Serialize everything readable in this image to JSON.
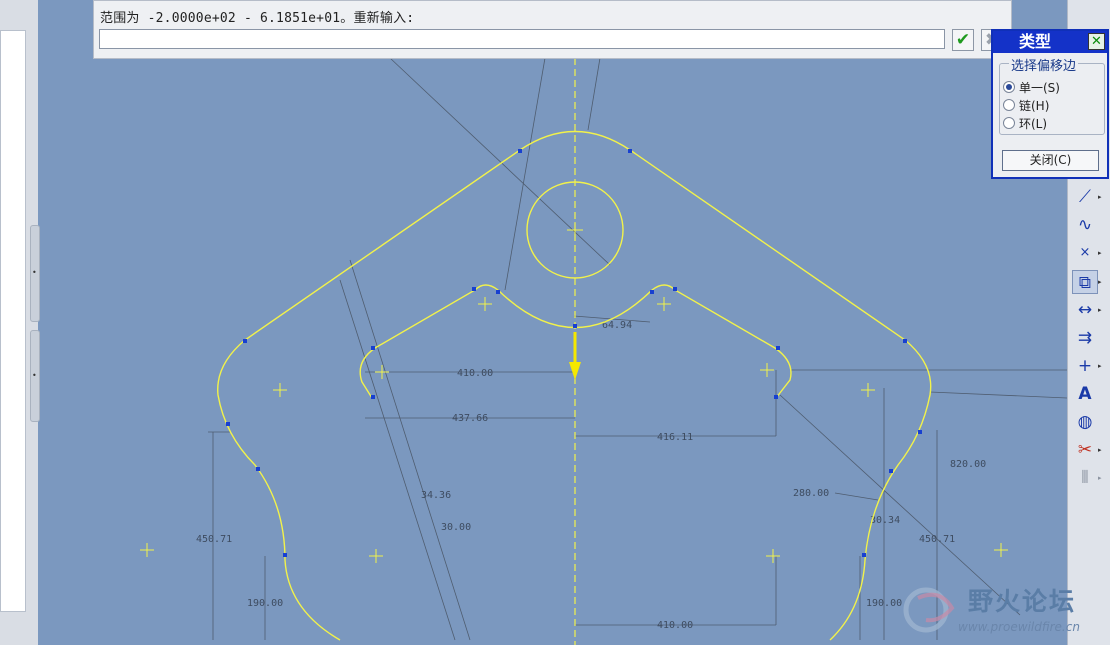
{
  "prompt": {
    "message": "范围为 -2.0000e+02 - 6.1851e+01。重新输入:",
    "input_value": "",
    "ok_icon": "check-icon",
    "cancel_icon": "x-icon"
  },
  "dialog": {
    "title": "类型",
    "group_label": "选择偏移边",
    "options": [
      {
        "label": "单一(S)",
        "selected": true
      },
      {
        "label": "链(H)",
        "selected": false
      },
      {
        "label": "环(L)",
        "selected": false
      }
    ],
    "close_button": "关闭(C)"
  },
  "dimensions": [
    "410.00",
    "437.66",
    "416.11",
    "64.94",
    "34.36",
    "30.00",
    "450.71",
    "190.00",
    "410.00",
    "280.00",
    "30.34",
    "450.71",
    "190.00",
    "820.00"
  ],
  "toolbar": [
    "line-tool-icon",
    "spline-tool-icon",
    "point-tool-icon",
    "offset-edge-icon",
    "dimension-icon",
    "modify-icon",
    "constraint-icon",
    "text-icon",
    "palette-icon",
    "trim-icon",
    "mirror-icon"
  ],
  "colors": {
    "background": "#7b98bf",
    "sketch": "#f2f24a",
    "dialog_title": "#1432c8"
  },
  "watermark": {
    "text": "野火论坛",
    "url": "www.proewildfire.cn"
  }
}
